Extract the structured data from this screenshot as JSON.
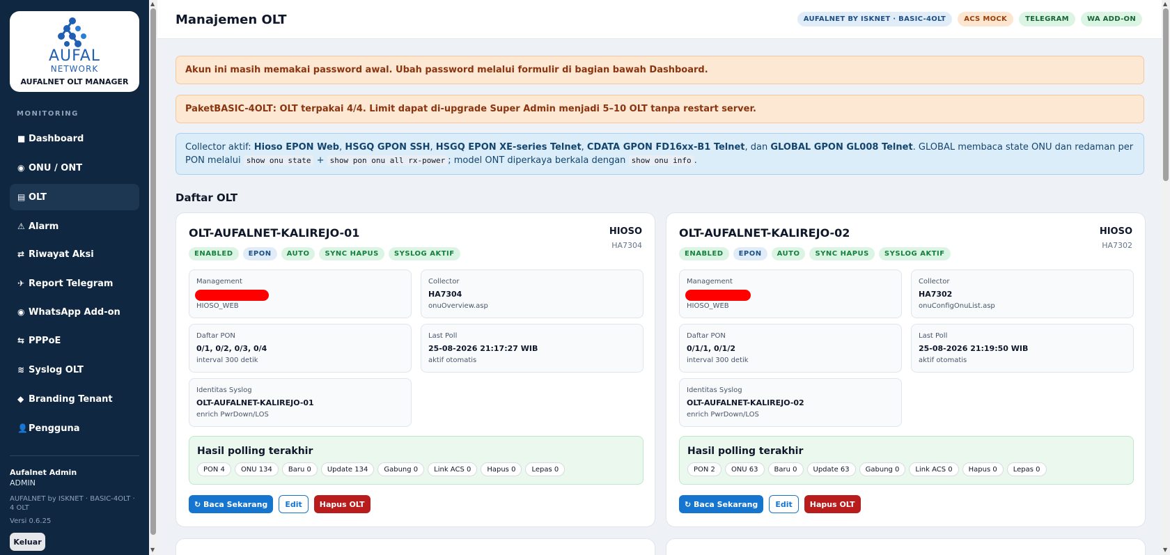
{
  "sidebar": {
    "logo": {
      "wordmark": "AUFAL",
      "subtitle": "NETWORK",
      "app_name": "AUFALNET OLT MANAGER"
    },
    "section_heading": "MONITORING",
    "items": [
      {
        "icon": "■",
        "label": "Dashboard",
        "icon_name": "dashboard-icon"
      },
      {
        "icon": "◉",
        "label": "ONU / ONT",
        "icon_name": "onu-icon"
      },
      {
        "icon": "▤",
        "label": "OLT",
        "icon_name": "olt-icon",
        "active": true
      },
      {
        "icon": "⚠",
        "label": "Alarm",
        "icon_name": "alarm-icon"
      },
      {
        "icon": "⇄",
        "label": "Riwayat Aksi",
        "icon_name": "history-icon"
      },
      {
        "icon": "✈",
        "label": "Report Telegram",
        "icon_name": "telegram-icon"
      },
      {
        "icon": "◉",
        "label": "WhatsApp Add-on",
        "icon_name": "whatsapp-icon"
      },
      {
        "icon": "⇆",
        "label": "PPPoE",
        "icon_name": "pppoe-icon"
      },
      {
        "icon": "≋",
        "label": "Syslog OLT",
        "icon_name": "syslog-icon"
      },
      {
        "icon": "◆",
        "label": "Branding Tenant",
        "icon_name": "branding-icon"
      },
      {
        "icon": "👤",
        "label": "Pengguna",
        "icon_name": "user-icon"
      }
    ],
    "user": {
      "name": "Aufalnet Admin",
      "role": "ADMIN"
    },
    "tenant_strong": "AUFALNET by ISKNET",
    "tenant_rest": " · BASIC-4OLT · 4 OLT",
    "version": "Versi 0.6.25",
    "logout_label": "Keluar"
  },
  "header": {
    "title": "Manajemen OLT",
    "badges": [
      {
        "label": "AUFALNET BY ISKNET · BASIC-4OLT",
        "style": "blue"
      },
      {
        "label": "ACS MOCK",
        "style": "orange"
      },
      {
        "label": "TELEGRAM",
        "style": "green"
      },
      {
        "label": "WA ADD-ON",
        "style": "green"
      }
    ]
  },
  "alerts": {
    "password": "Akun ini masih memakai password awal. Ubah password melalui formulir di bagian bawah Dashboard.",
    "package_prefix": "Paket ",
    "package_name": "BASIC-4OLT",
    "package_rest": ": OLT terpakai 4/4. Limit dapat di-upgrade Super Admin menjadi 5–10 OLT tanpa restart server.",
    "collector": {
      "t1": "Collector aktif: ",
      "b1": "Hioso EPON Web",
      "t2": ", ",
      "b2": "HSGQ GPON SSH",
      "t3": ", ",
      "b3": "HSGQ EPON XE-series Telnet",
      "t4": ", ",
      "b4": "CDATA GPON FD16xx-B1 Telnet",
      "t5": ", dan ",
      "b5": "GLOBAL GPON GL008 Telnet",
      "t6": ". GLOBAL membaca state ONU dan redaman per PON melalui ",
      "c1": "show onu state",
      "t7": " + ",
      "c2": "show pon onu all rx-power",
      "t8": "; model ONT diperkaya berkala dengan ",
      "c3": "show onu info",
      "t9": "."
    }
  },
  "section_title": "Daftar OLT",
  "olts": [
    {
      "name": "OLT-AUFALNET-KALIREJO-01",
      "vendor": "HIOSO",
      "model": "HA7304",
      "tags": [
        "ENABLED",
        "EPON",
        "AUTO",
        "SYNC HAPUS",
        "SYSLOG AKTIF"
      ],
      "management": {
        "label": "Management",
        "sub": "HIOSO_WEB"
      },
      "collector": {
        "label": "Collector",
        "value": "HA7304",
        "sub": "onuOverview.asp"
      },
      "pon": {
        "label": "Daftar PON",
        "value": "0/1, 0/2, 0/3, 0/4",
        "sub": "interval 300 detik"
      },
      "last_poll": {
        "label": "Last Poll",
        "value": "25-08-2026 21:17:27 WIB",
        "sub": "aktif otomatis"
      },
      "syslog": {
        "label": "Identitas Syslog",
        "value": "OLT-AUFALNET-KALIREJO-01",
        "sub": "enrich PwrDown/LOS"
      },
      "poll_title": "Hasil polling terakhir",
      "chips": [
        "PON 4",
        "ONU 134",
        "Baru 0",
        "Update 134",
        "Gabung 0",
        "Link ACS 0",
        "Hapus 0",
        "Lepas 0"
      ],
      "actions": {
        "read": "↻ Baca Sekarang",
        "edit": "Edit",
        "delete": "Hapus OLT"
      }
    },
    {
      "name": "OLT-AUFALNET-KALIREJO-02",
      "vendor": "HIOSO",
      "model": "HA7302",
      "tags": [
        "ENABLED",
        "EPON",
        "AUTO",
        "SYNC HAPUS",
        "SYSLOG AKTIF"
      ],
      "management": {
        "label": "Management",
        "sub": "HIOSO_WEB"
      },
      "collector": {
        "label": "Collector",
        "value": "HA7302",
        "sub": "onuConfigOnuList.asp"
      },
      "pon": {
        "label": "Daftar PON",
        "value": "0/1/1, 0/1/2",
        "sub": "interval 300 detik"
      },
      "last_poll": {
        "label": "Last Poll",
        "value": "25-08-2026 21:19:50 WIB",
        "sub": "aktif otomatis"
      },
      "syslog": {
        "label": "Identitas Syslog",
        "value": "OLT-AUFALNET-KALIREJO-02",
        "sub": "enrich PwrDown/LOS"
      },
      "poll_title": "Hasil polling terakhir",
      "chips": [
        "PON 2",
        "ONU 63",
        "Baru 0",
        "Update 63",
        "Gabung 0",
        "Link ACS 0",
        "Hapus 0",
        "Lepas 0"
      ],
      "actions": {
        "read": "↻ Baca Sekarang",
        "edit": "Edit",
        "delete": "Hapus OLT"
      }
    }
  ]
}
